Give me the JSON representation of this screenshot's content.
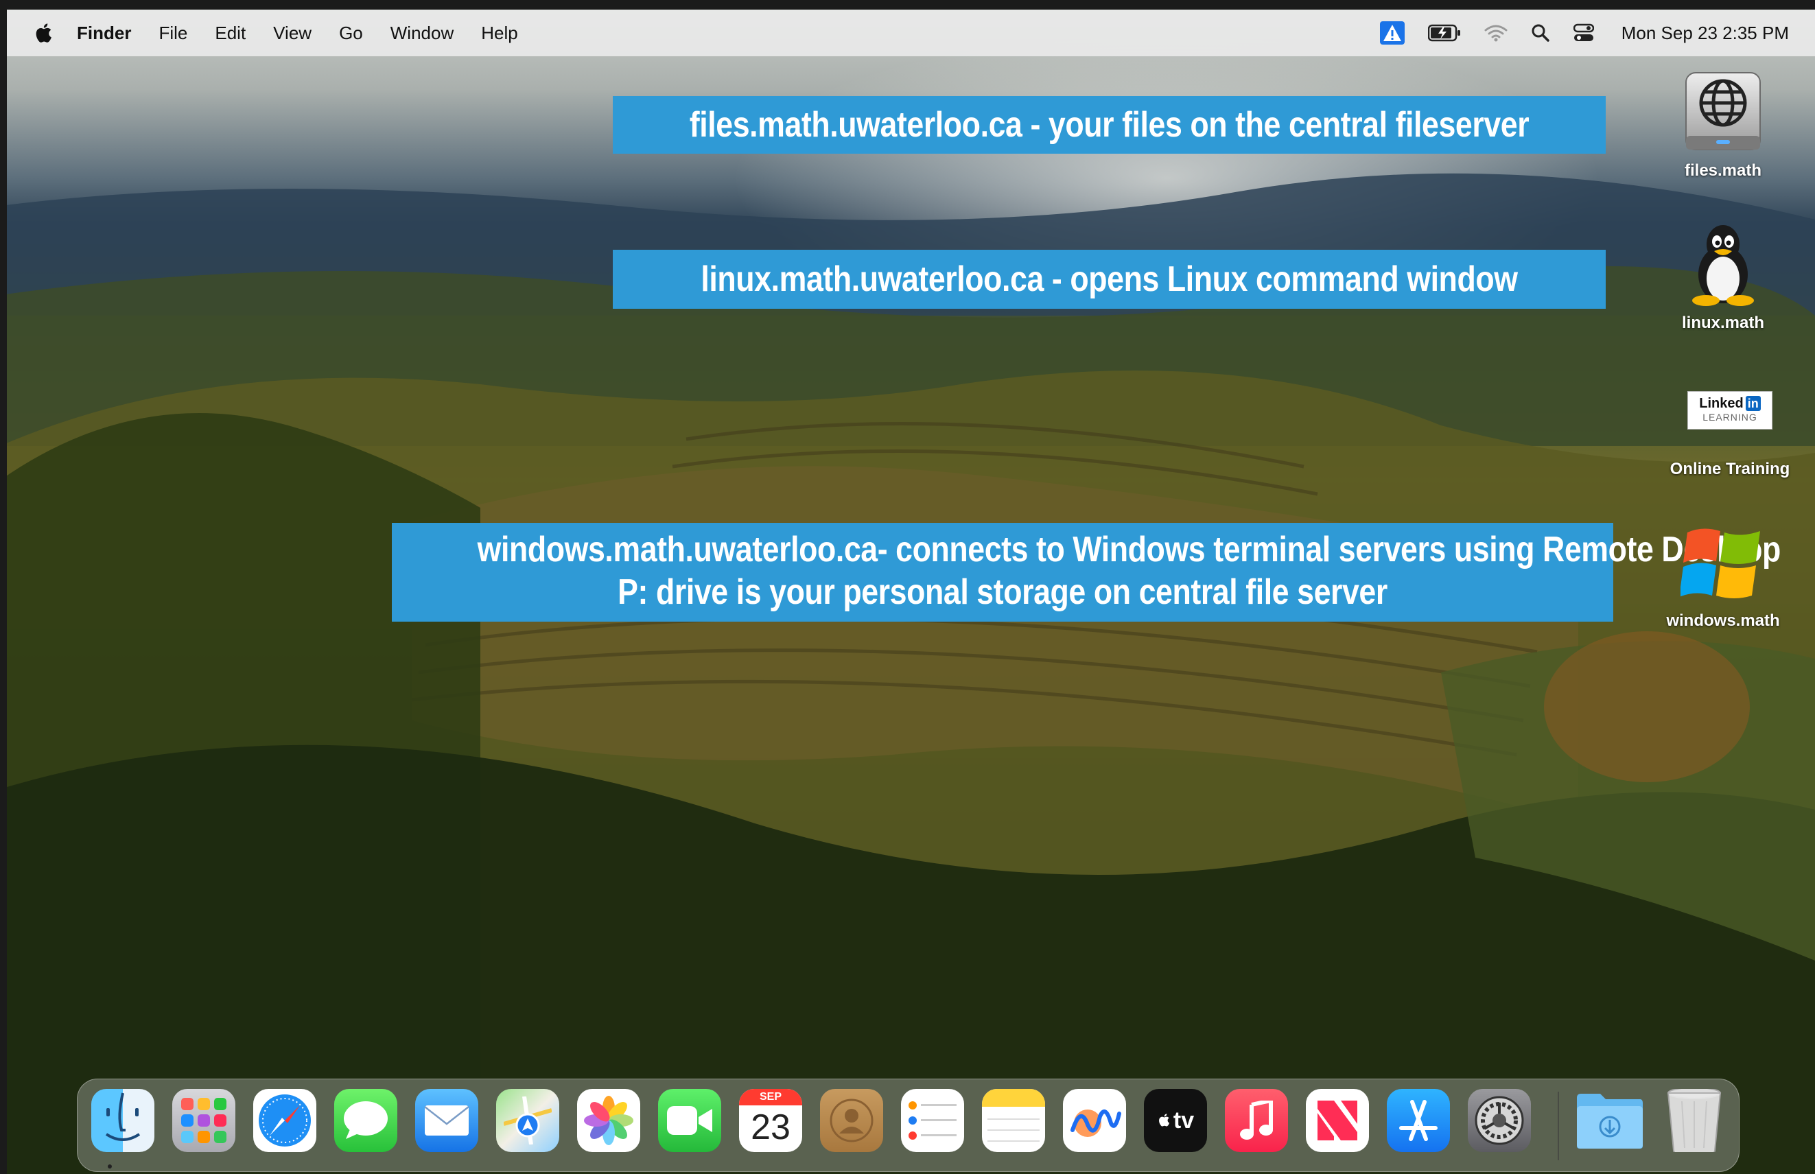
{
  "menubar": {
    "apple_icon": "apple-logo-icon",
    "app_name": "Finder",
    "menus": [
      "File",
      "Edit",
      "View",
      "Go",
      "Window",
      "Help"
    ],
    "status_icons": [
      "alert-icon",
      "battery-charging-icon",
      "wifi-icon",
      "search-icon",
      "control-center-icon"
    ],
    "clock": "Mon Sep 23  2:35 PM"
  },
  "banners": {
    "files": "files.math.uwaterloo.ca - your files on the central fileserver",
    "linux": "linux.math.uwaterloo.ca - opens Linux command window",
    "windows_line1": "windows.math.uwaterloo.ca- connects to Windows terminal servers using Remote Desktop",
    "windows_line2": "P: drive is your personal storage on central file server"
  },
  "desktop_icons": {
    "files": {
      "label": "files.math",
      "icon": "network-drive-icon"
    },
    "linux": {
      "label": "linux.math",
      "icon": "tux-penguin-icon"
    },
    "training": {
      "label": "Online Training",
      "icon": "linkedin-learning-icon",
      "logo_text": "Linked",
      "logo_in": "in",
      "logo_sub": "LEARNING"
    },
    "windows": {
      "label": "windows.math",
      "icon": "windows-logo-icon"
    }
  },
  "dock": {
    "apps": [
      "Finder",
      "Launchpad",
      "Safari",
      "Messages",
      "Mail",
      "Maps",
      "Photos",
      "FaceTime",
      "Calendar",
      "Contacts",
      "Reminders",
      "Notes",
      "Freeform",
      "TV",
      "Music",
      "News",
      "App Store",
      "System Settings",
      "Downloads",
      "Trash"
    ],
    "calendar_month": "SEP",
    "calendar_day": "23",
    "tv_label": "tv"
  },
  "colors": {
    "banner_blue": "#2f9ad6",
    "menubar_bg": "#ececec"
  }
}
